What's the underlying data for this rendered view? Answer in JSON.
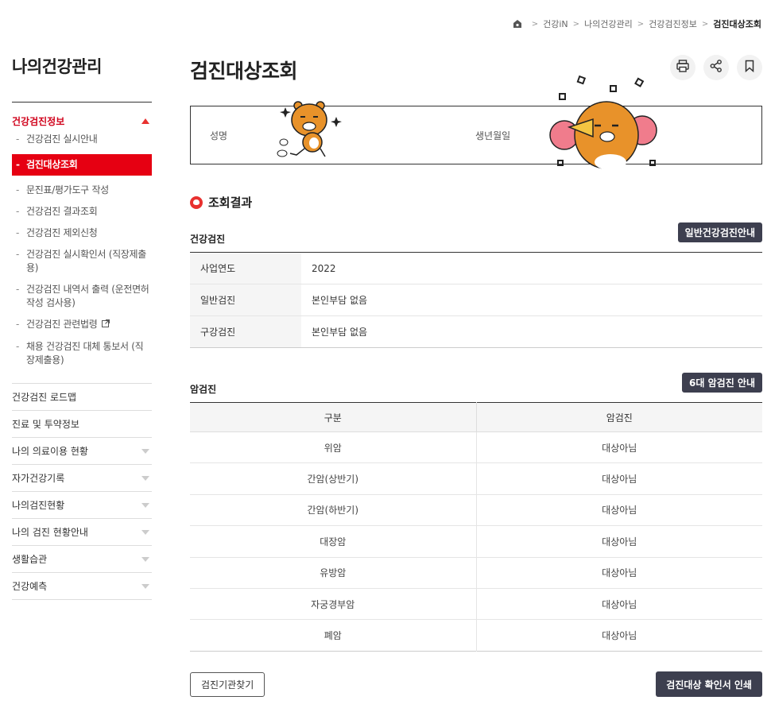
{
  "breadcrumb": {
    "items": [
      "건강iN",
      "나의건강관리",
      "건강검진정보"
    ],
    "current": "검진대상조회"
  },
  "sidebar": {
    "title": "나의건강관리",
    "active_group": "건강검진정보",
    "sub_items": [
      {
        "label": "건강검진 실시안내"
      },
      {
        "label": "검진대상조회"
      },
      {
        "label": "문진표/평가도구 작성"
      },
      {
        "label": "건강검진 결과조회"
      },
      {
        "label": "건강검진 제외신청"
      },
      {
        "label": "건강검진 실시확인서 (직장제출용)"
      },
      {
        "label": "건강검진 내역서 출력 (운전면허작성 검사용)"
      },
      {
        "label": "건강검진 관련법령"
      },
      {
        "label": "채용 건강검진 대체 통보서 (직장제출용)"
      }
    ],
    "main_items": [
      {
        "label": "건강검진 로드맵",
        "has_arrow": false
      },
      {
        "label": "진료 및 투약정보",
        "has_arrow": false
      },
      {
        "label": "나의 의료이용 현황",
        "has_arrow": true
      },
      {
        "label": "자가건강기록",
        "has_arrow": true
      },
      {
        "label": "나의검진현황",
        "has_arrow": true
      },
      {
        "label": "나의 검진 현황안내",
        "has_arrow": true
      },
      {
        "label": "생활습관",
        "has_arrow": true
      },
      {
        "label": "건강예측",
        "has_arrow": true
      }
    ]
  },
  "page": {
    "title": "검진대상조회"
  },
  "info": {
    "name_label": "성명",
    "birth_label": "생년월일"
  },
  "result": {
    "title": "조회결과",
    "health": {
      "heading": "건강검진",
      "guide_button": "일반건강검진안내",
      "rows": [
        {
          "key": "사업연도",
          "value": "2022"
        },
        {
          "key": "일반검진",
          "value": "본인부담 없음"
        },
        {
          "key": "구강검진",
          "value": "본인부담 없음"
        }
      ]
    },
    "cancer": {
      "heading": "암검진",
      "guide_button": "6대 암검진 안내",
      "columns": [
        "구분",
        "암검진"
      ],
      "rows": [
        [
          "위암",
          "대상아님"
        ],
        [
          "간암(상반기)",
          "대상아님"
        ],
        [
          "간암(하반기)",
          "대상아님"
        ],
        [
          "대장암",
          "대상아님"
        ],
        [
          "유방암",
          "대상아님"
        ],
        [
          "자궁경부암",
          "대상아님"
        ],
        [
          "폐암",
          "대상아님"
        ]
      ]
    }
  },
  "buttons": {
    "find_institution": "검진기관찾기",
    "print_certificate": "검진대상 확인서 인쇄"
  },
  "colors": {
    "accent_red": "#e60012",
    "dark_button": "#3d3f4f"
  }
}
